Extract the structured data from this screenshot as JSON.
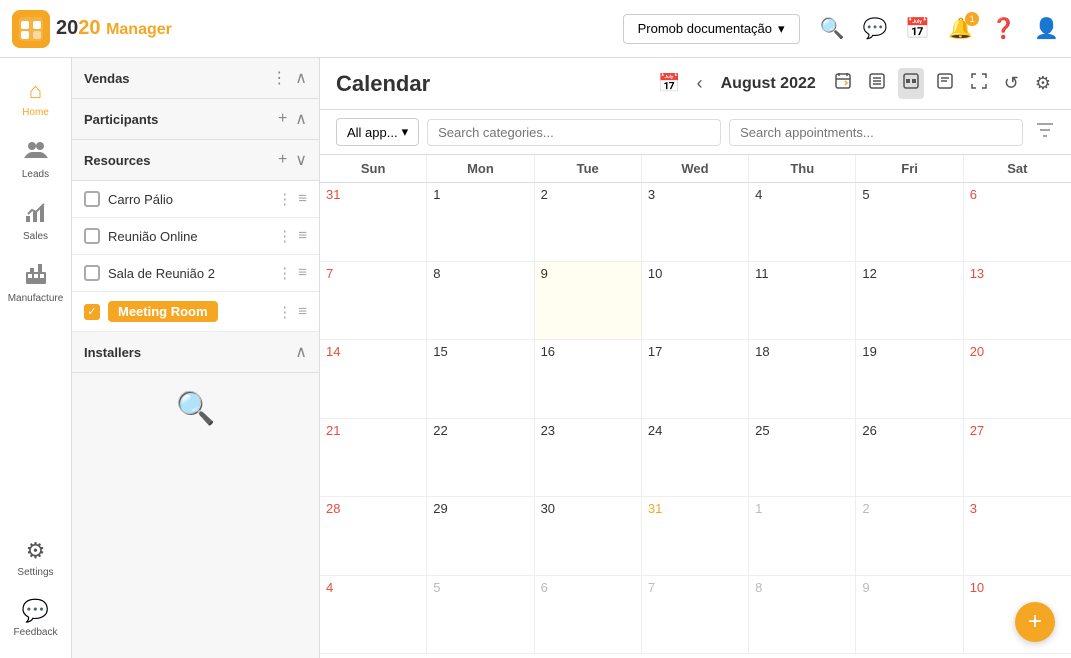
{
  "app": {
    "logo_text": "20",
    "logo_orange": "20",
    "logo_manager": "Manager"
  },
  "topnav": {
    "workspace": "Promob documentação",
    "workspace_arrow": "▾",
    "icons": [
      "search",
      "chat",
      "calendar",
      "bell",
      "help",
      "user"
    ],
    "bell_badge": "1"
  },
  "sidebar": {
    "items": [
      {
        "id": "home",
        "label": "Home",
        "icon": "⌂",
        "active": true
      },
      {
        "id": "leads",
        "label": "Leads",
        "icon": "👥"
      },
      {
        "id": "sales",
        "label": "Sales",
        "icon": "🤝"
      },
      {
        "id": "manufacture",
        "label": "Manufacture",
        "icon": "🏭"
      }
    ],
    "bottom_items": [
      {
        "id": "settings",
        "label": "Settings",
        "icon": "⚙"
      },
      {
        "id": "feedback",
        "label": "Feedback",
        "icon": "💬"
      }
    ]
  },
  "left_panel": {
    "sections": [
      {
        "id": "vendas",
        "title": "Vendas",
        "has_plus": false,
        "collapsed": false
      },
      {
        "id": "participants",
        "title": "Participants",
        "has_plus": true,
        "collapsed": false
      },
      {
        "id": "resources",
        "title": "Resources",
        "has_plus": true,
        "collapsed": false
      }
    ],
    "resources": [
      {
        "id": "carro-palio",
        "name": "Carro Pálio",
        "checked": false
      },
      {
        "id": "reuniao-online",
        "name": "Reunião Online",
        "checked": false
      },
      {
        "id": "sala-reuniao-2",
        "name": "Sala de Reunião 2",
        "checked": false
      },
      {
        "id": "meeting-room",
        "name": "Meeting Room",
        "checked": true
      }
    ],
    "installers": {
      "title": "Installers",
      "collapsed": false
    },
    "search_placeholder": "Search..."
  },
  "calendar": {
    "title": "Calendar",
    "month": "August 2022",
    "filter": {
      "type_label": "All app...",
      "cat_placeholder": "Search categories...",
      "appt_placeholder": "Search appointments..."
    },
    "days": [
      "Sun",
      "Mon",
      "Tue",
      "Wed",
      "Thu",
      "Fri",
      "Sat"
    ],
    "weeks": [
      [
        {
          "num": "31",
          "other": true
        },
        {
          "num": "1"
        },
        {
          "num": "2"
        },
        {
          "num": "3"
        },
        {
          "num": "4"
        },
        {
          "num": "5"
        },
        {
          "num": "6"
        }
      ],
      [
        {
          "num": "7"
        },
        {
          "num": "8"
        },
        {
          "num": "9",
          "today": true
        },
        {
          "num": "10"
        },
        {
          "num": "11"
        },
        {
          "num": "12"
        },
        {
          "num": "13"
        }
      ],
      [
        {
          "num": "14"
        },
        {
          "num": "15"
        },
        {
          "num": "16"
        },
        {
          "num": "17"
        },
        {
          "num": "18"
        },
        {
          "num": "19"
        },
        {
          "num": "20"
        }
      ],
      [
        {
          "num": "21",
          "orange": true
        },
        {
          "num": "22"
        },
        {
          "num": "23"
        },
        {
          "num": "24"
        },
        {
          "num": "25"
        },
        {
          "num": "26"
        },
        {
          "num": "27"
        }
      ],
      [
        {
          "num": "28"
        },
        {
          "num": "29"
        },
        {
          "num": "30"
        },
        {
          "num": "31",
          "orange": true
        },
        {
          "num": "1",
          "other": true
        },
        {
          "num": "2",
          "other": true
        },
        {
          "num": "3",
          "other": true
        }
      ],
      [
        {
          "num": "4",
          "other": true
        },
        {
          "num": "5",
          "other": true
        },
        {
          "num": "6",
          "other": true
        },
        {
          "num": "7",
          "other": true
        },
        {
          "num": "8",
          "other": true
        },
        {
          "num": "9",
          "other": true
        },
        {
          "num": "10",
          "other": true
        }
      ]
    ],
    "fab": "+"
  }
}
